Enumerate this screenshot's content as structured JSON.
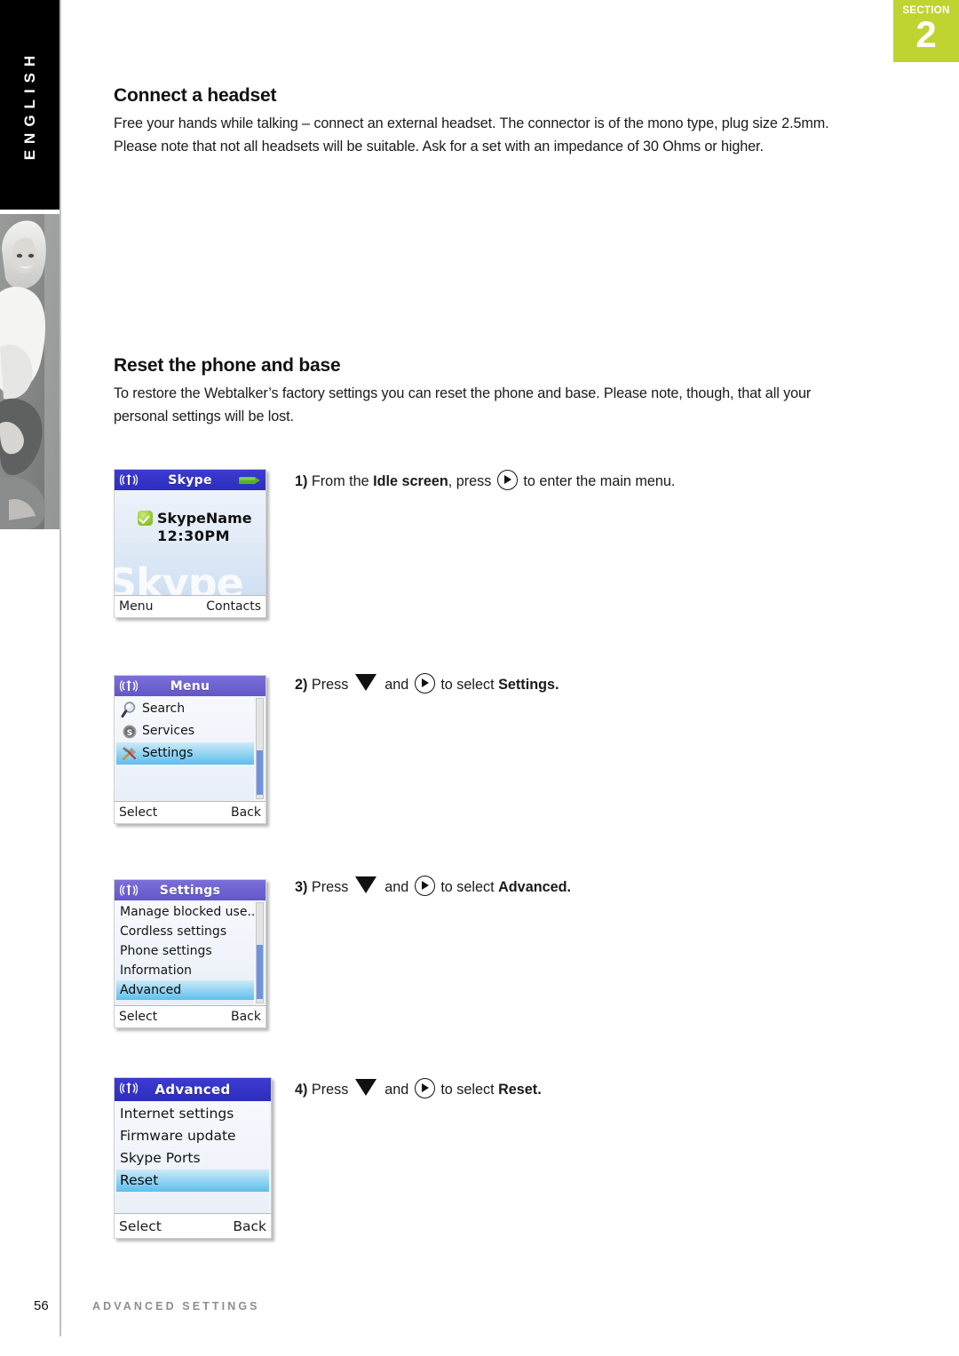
{
  "sidebar": {
    "language_label": "ENGLISH",
    "photo_alt": "woman-smiling-photo"
  },
  "section_badge": {
    "label": "SECTION",
    "number": "2",
    "color": "#bfd431"
  },
  "sections": [
    {
      "heading": "Connect a headset",
      "body": "Free your hands while talking – connect an external headset. The connector is of the mono type, plug size 2.5mm. Please note that not all headsets will be suitable. Ask for a set with an impedance of 30 Ohms or higher."
    },
    {
      "heading": "Reset the phone and base",
      "body": "To restore the Webtalker’s factory settings you can reset the phone and base. Please note, though, that all your personal settings will be lost."
    }
  ],
  "steps": [
    {
      "number": "1)",
      "text_parts": [
        "From the ",
        "Idle screen",
        ", press ",
        "",
        " to enter the main menu."
      ],
      "pre": "From the ",
      "bold1": "Idle screen",
      "mid": ", press",
      "post": "to enter the main menu.",
      "icons": [
        "right-arrow-key-icon"
      ]
    },
    {
      "number": "2)",
      "pre": "Press",
      "mid": "and",
      "post": "to select",
      "bold2": "Settings.",
      "icons": [
        "down-arrow-key-icon",
        "right-arrow-key-icon"
      ]
    },
    {
      "number": "3)",
      "pre": "Press",
      "mid": "and",
      "post": "to select",
      "bold2": "Advanced.",
      "icons": [
        "down-arrow-key-icon",
        "right-arrow-key-icon"
      ]
    },
    {
      "number": "4)",
      "pre": "Press",
      "mid": "and",
      "post": "to select",
      "bold2": "Reset.",
      "icons": [
        "down-arrow-key-icon",
        "right-arrow-key-icon"
      ]
    }
  ],
  "screens": {
    "idle": {
      "title": "Skype",
      "user": "SkypeName",
      "time": "12:30PM",
      "watermark": "Skype",
      "softkey_left": "Menu",
      "softkey_right": "Contacts",
      "title_color": "#3232c8"
    },
    "menu": {
      "title": "Menu",
      "items": [
        {
          "label": "Search",
          "icon": "magnifier-icon",
          "selected": false
        },
        {
          "label": "Services",
          "icon": "skype-s-icon",
          "selected": false
        },
        {
          "label": "Settings",
          "icon": "tools-icon",
          "selected": true
        }
      ],
      "softkey_left": "Select",
      "softkey_right": "Back",
      "title_color": "#6257c8"
    },
    "settings": {
      "title": "Settings",
      "items": [
        {
          "label": "Manage blocked use..",
          "selected": false
        },
        {
          "label": "Cordless settings",
          "selected": false
        },
        {
          "label": "Phone settings",
          "selected": false
        },
        {
          "label": "Information",
          "selected": false
        },
        {
          "label": "Advanced",
          "selected": true
        }
      ],
      "softkey_left": "Select",
      "softkey_right": "Back",
      "title_color": "#6257c8"
    },
    "advanced": {
      "title": "Advanced",
      "items": [
        {
          "label": "Internet settings",
          "selected": false
        },
        {
          "label": "Firmware update",
          "selected": false
        },
        {
          "label": "Skype Ports",
          "selected": false
        },
        {
          "label": "Reset",
          "selected": true
        }
      ],
      "softkey_left": "Select",
      "softkey_right": "Back",
      "title_color": "#3232c8"
    }
  },
  "footer": {
    "page_number": "56",
    "title": "ADVANCED SETTINGS"
  }
}
